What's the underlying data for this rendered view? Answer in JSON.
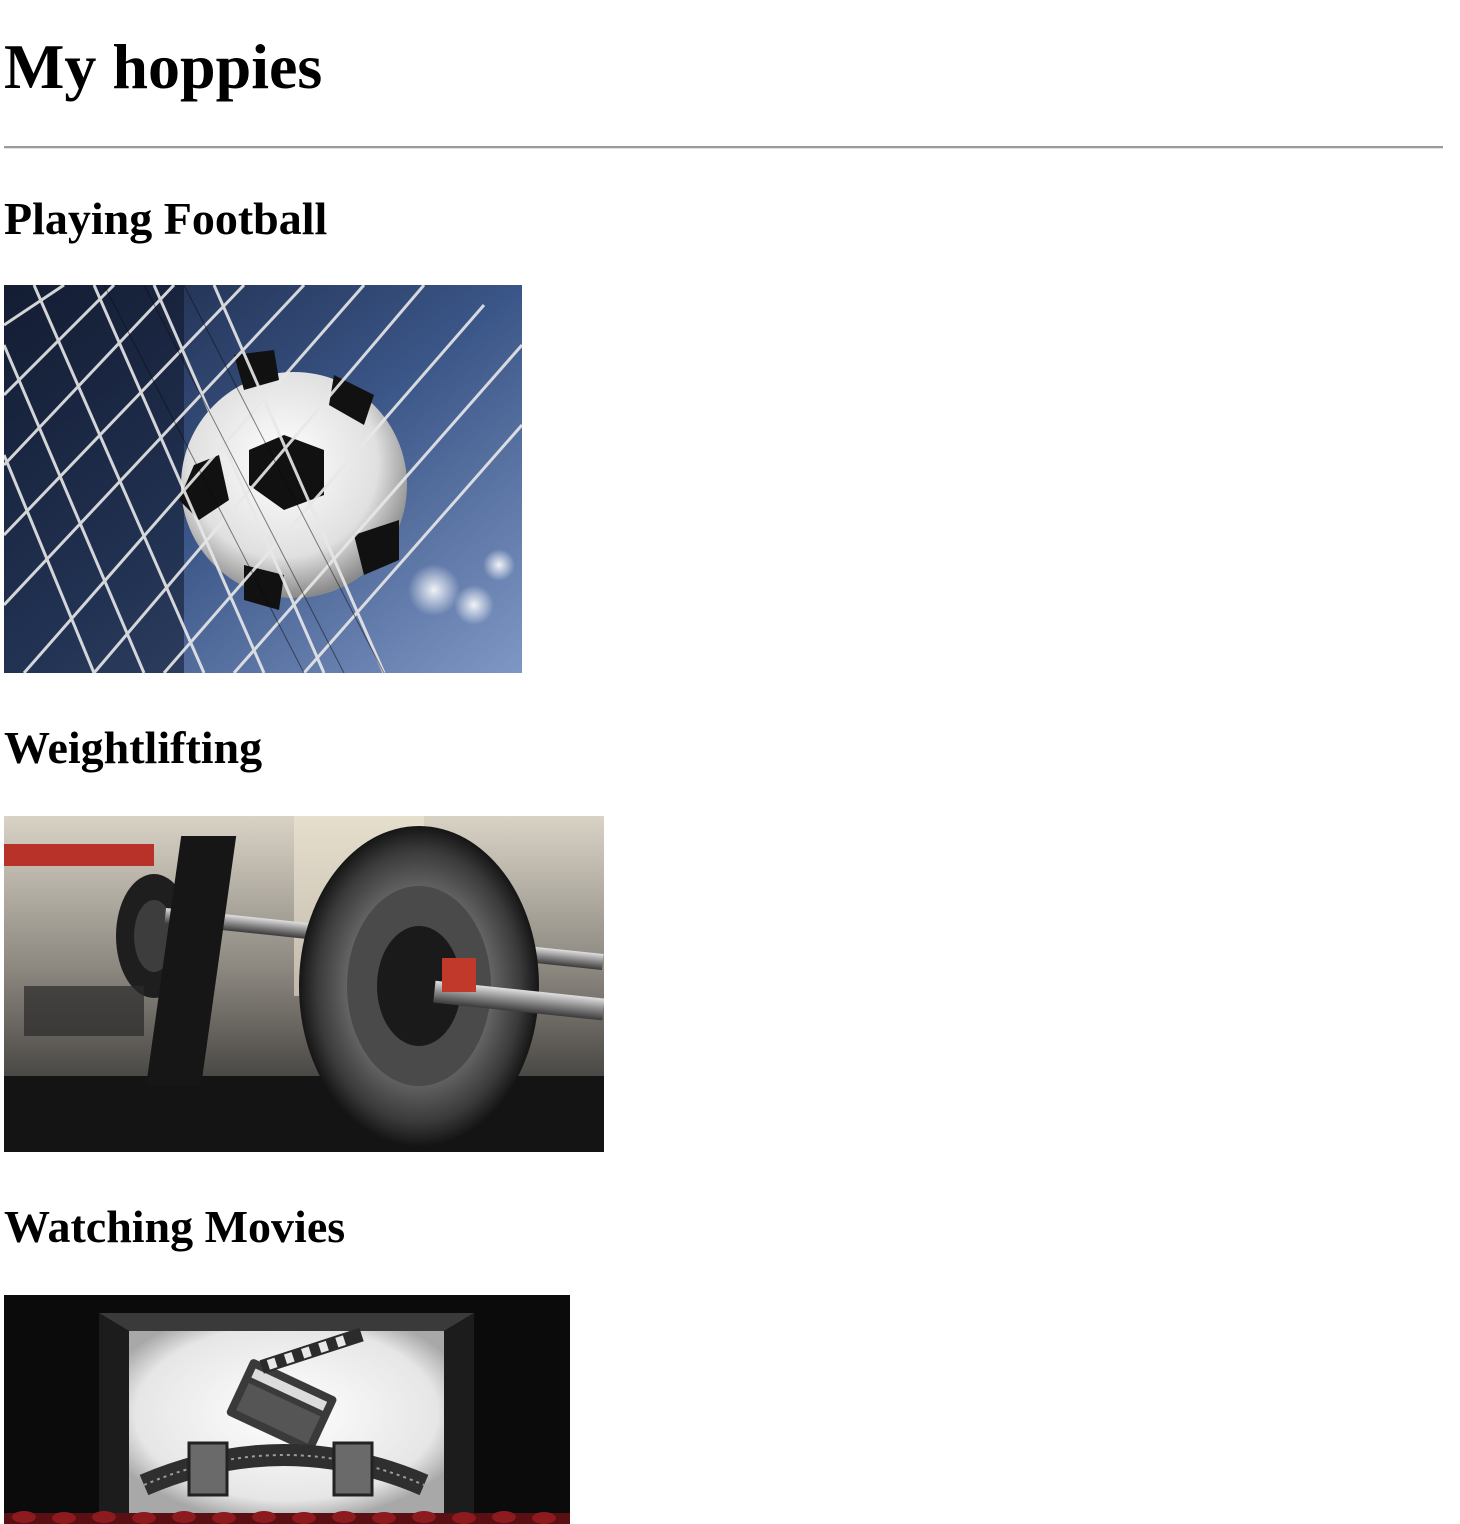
{
  "page": {
    "title": "My hoppies"
  },
  "hobbies": [
    {
      "heading": "Playing Football",
      "image": "soccer-ball-in-net-photo"
    },
    {
      "heading": "Weightlifting",
      "image": "barbell-weight-plate-photo"
    },
    {
      "heading": "Watching Movies",
      "image": "cinema-screen-clapperboard-photo"
    }
  ],
  "colors": {
    "text": "#000000",
    "rule": "#9a9a9a",
    "background": "#ffffff"
  }
}
